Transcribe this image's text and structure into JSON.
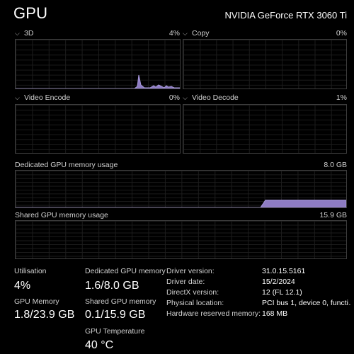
{
  "header": {
    "title": "GPU",
    "gpu_name": "NVIDIA GeForce RTX 3060 Ti"
  },
  "colors": {
    "graph_fill": "#8e7cc3",
    "graph_line": "#a898dd",
    "grid": "#1c1c1c",
    "border": "#3d3d3d"
  },
  "engines": [
    {
      "label": "3D",
      "value": "4%"
    },
    {
      "label": "Copy",
      "value": "0%"
    },
    {
      "label": "Video Encode",
      "value": "0%"
    },
    {
      "label": "Video Decode",
      "value": "1%"
    }
  ],
  "dedicated_memory": {
    "label": "Dedicated GPU memory usage",
    "value": "8.0 GB",
    "usage_fraction": 0.2
  },
  "shared_memory": {
    "label": "Shared GPU memory usage",
    "value": "15.9 GB"
  },
  "stats": {
    "utilisation": {
      "label": "Utilisation",
      "value": "4%"
    },
    "dedicated": {
      "label": "Dedicated GPU memory",
      "value": "1.6/8.0 GB"
    },
    "gpu_memory": {
      "label": "GPU Memory",
      "value": "1.8/23.9 GB"
    },
    "shared": {
      "label": "Shared GPU memory",
      "value": "0.1/15.9 GB"
    },
    "temperature": {
      "label": "GPU Temperature",
      "value": "40 °C"
    }
  },
  "info": [
    {
      "label": "Driver version:",
      "value": "31.0.15.5161"
    },
    {
      "label": "Driver date:",
      "value": "15/2/2024"
    },
    {
      "label": "DirectX version:",
      "value": "12 (FL 12.1)"
    },
    {
      "label": "Physical location:",
      "value": "PCI bus 1, device 0, functi…"
    },
    {
      "label": "Hardware reserved memory:",
      "value": "168 MB"
    }
  ]
}
